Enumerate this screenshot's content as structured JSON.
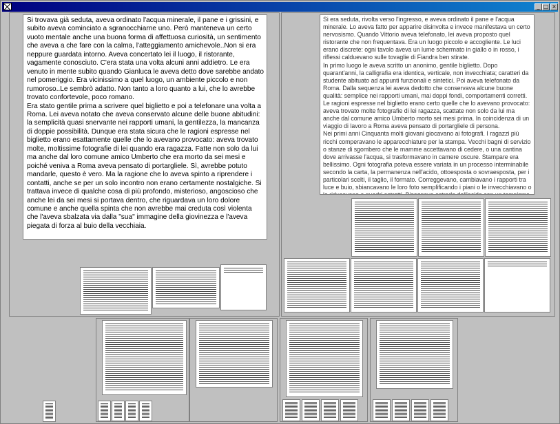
{
  "window": {
    "minimize_glyph": "_",
    "maximize_glyph": "□",
    "close_glyph": "×",
    "titlebar_color": "#000080"
  },
  "doc_left": {
    "paragraphs": [
      "Si trovava già seduta, aveva ordinato l'acqua minerale, il pane e i grissini, e subito aveva cominciato a sgranocchiarne uno. Però manteneva un certo vuoto mentale anche una buona forma di affettuosa curiosità, un sentimento che aveva a che fare con la calma, l'atteggiamento amichevole..Non si era neppure guardata intorno. Aveva concertato lei il luogo, il ristorante, vagamente conosciuto. C'era stata una volta alcuni anni addietro. Le era venuto in mente subito quando Gianluca le aveva detto dove sarebbe andato nel pomeriggio. Era vicinissimo a quel luogo, un ambiente piccolo e non rumoroso..Le sembrò adatto. Non tanto a loro quanto a lui, che lo avrebbe trovato confortevole, poco romano.",
      "Era stato gentile prima a scrivere quel biglietto e poi a telefonare una volta a Roma. Lei aveva notato che aveva conservato alcune delle buone abitudini: la semplicità quasi snervante nei rapporti umani, la gentilezza, la mancanza di doppie possibilità. Dunque era stata sicura che le ragioni espresse nel biglietto erano esattamente quelle che lo avevano provocato: aveva trovato molte, moltissime fotografie di lei quando era ragazza. Fatte non solo da lui ma anche dal loro comune amico Umberto che era morto da sei mesi e poiché veniva a Roma aveva pensato di portargliele. Sì, avrebbe potuto mandarle, questo è vero. Ma la ragione che lo aveva spinto a riprendere i contatti, anche se per un solo incontro non erano certamente nostalgiche. Si trattava invece di qualche cosa di più profondo, misterioso, angosciosо che anche lei da sei mesi si portava dentro, che riguardava un loro dolore comune e anche quella spinta che non avrebbe mai creduta così violenta che l'aveva sbalzata via dalla \"sua\" immagine della giovinezza e l'aveva piegata di forza al buio della vecchiaia."
    ]
  },
  "doc_right": {
    "paragraphs": [
      "Si era seduta, rivolta verso l'ingresso, e aveva ordinato il pane e l'acqua minerale. Lo aveva fatto per apparire disinvolta e invece manifestava un certo nervosismo. Quando Vittorio aveva telefonato, lei aveva proposto quel ristorante che non frequentava. Era un luogo piccolo e accogliente. Le luci erano discrete: ogni tavolo aveva un lume schermato in giallo o in rosso, i riflessi calduevano sulle tovaglie di Fiandra ben stirate.",
      "In primo luogo le aveva scritto un anonimo, gentile biglietto. Dopo quarant'anni, la calligrafia era identica, verticale, non invecchiata; caratteri da studente abituato ad appunti funzionali e sintetici. Poi aveva telefonato da Roma. Dalla sequenza lei aveva dedotto che conservava alcune buone qualità: semplice nei rapporti umani, mai doppi fondi, comportamenti corretti. Le ragioni espresse nel biglietto erano certo quelle che lo avevano provocato: aveva trovato molte fotografie di lei ragazza, scattate non solo da lui ma anche dal comune amico Umberto morto sei mesi prima. In coincidenza di un viaggio di lavoro a Roma aveva pensato di portargliele di persona.",
      "Nei primi anni Cinquanta molti giovani giocavano ai fotografi. I ragazzi più ricchi comperavano le apparecchiature per la stampa. Vecchi bagni di servizio o stanze di sgombero che le mamme accettavano di cedere, o una cantina dove arrivasse l'acqua, si trasformavano in camere oscure. Stampare era bellissimo. Ogni fotografia poteva essere variata in un processo interminabile secondo la carta, la permanenza nell'acido, ottoesposta o sovraesposta, per i particolari scelti, il taglio, il formato. Correggevano, cambiavano i rapporti tra luce e buio, sbiancavano le loro foto semplificando i piani o le invecchiavano o le riducevano a quadri astratti. Bisognava estrarle dall'acido con un tempismo che"
    ]
  }
}
